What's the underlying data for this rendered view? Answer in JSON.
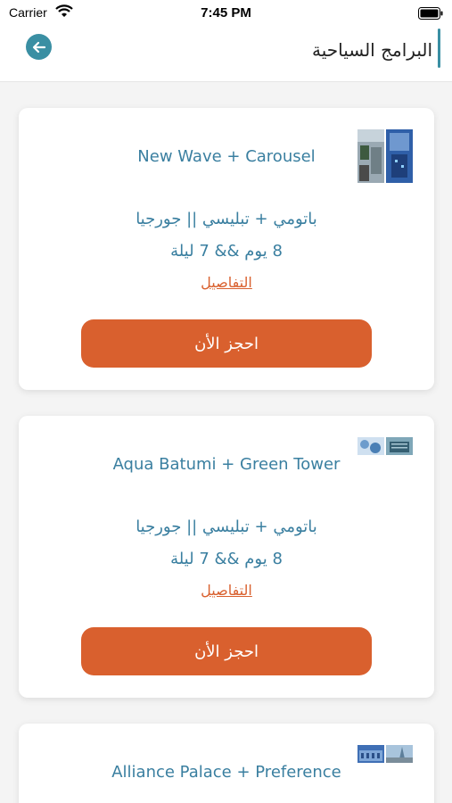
{
  "status_bar": {
    "carrier": "Carrier",
    "time": "7:45 PM"
  },
  "header": {
    "title": "البرامج السياحية",
    "back_icon": "arrow-left-icon"
  },
  "colors": {
    "accent": "#3a8fa3",
    "button": "#d9602e",
    "link": "#d9602e",
    "text": "#3a7fa0"
  },
  "programs": [
    {
      "hotels": "New Wave + Carousel",
      "destination": "باتومي + تبليسي || جورجيا",
      "duration": "8 يوم && 7 ليلة",
      "details_label": "التفاصيل",
      "book_label": "احجز الأن"
    },
    {
      "hotels": "Aqua Batumi + Green Tower",
      "destination": "باتومي + تبليسي || جورجيا",
      "duration": "8 يوم && 7 ليلة",
      "details_label": "التفاصيل",
      "book_label": "احجز الأن"
    },
    {
      "hotels": "Alliance Palace + Preference"
    }
  ]
}
